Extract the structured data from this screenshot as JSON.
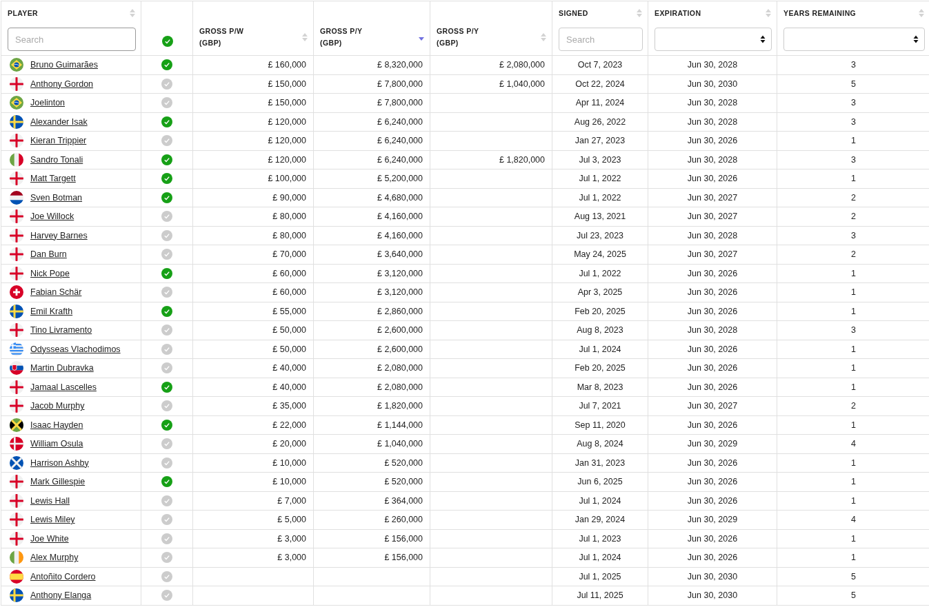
{
  "columns": [
    {
      "kind": "player",
      "label": "PLAYER",
      "sorted": false,
      "filter": {
        "kind": "search",
        "placeholder": "Search"
      }
    },
    {
      "kind": "check"
    },
    {
      "kind": "money",
      "label": "GROSS P/W",
      "sublabel": "(GBP)",
      "sorted": false
    },
    {
      "kind": "money",
      "label": "GROSS P/Y",
      "sublabel": "(GBP)",
      "sorted": true
    },
    {
      "kind": "money",
      "label": "GROSS P/Y",
      "sublabel": "(GBP)",
      "sorted": false
    },
    {
      "kind": "date",
      "label": "SIGNED",
      "sorted": false,
      "filter": {
        "kind": "search",
        "placeholder": "Search"
      }
    },
    {
      "kind": "date",
      "label": "EXPIRATION",
      "sorted": false,
      "filter": {
        "kind": "select"
      }
    },
    {
      "kind": "number",
      "label": "YEARS REMAINING",
      "sorted": false,
      "filter": {
        "kind": "select"
      }
    }
  ],
  "rows": [
    {
      "flag": {
        "kind": "br"
      },
      "name": "Bruno Guimarães",
      "verified": true,
      "pw": "£ 160,000",
      "py": "£ 8,320,000",
      "py2": "£ 2,080,000",
      "signed": "Oct 7, 2023",
      "expiration": "Jun 30, 2028",
      "years": "3"
    },
    {
      "flag": {
        "kind": "en"
      },
      "name": "Anthony Gordon",
      "verified": false,
      "pw": "£ 150,000",
      "py": "£ 7,800,000",
      "py2": "£ 1,040,000",
      "signed": "Oct 22, 2024",
      "expiration": "Jun 30, 2030",
      "years": "5"
    },
    {
      "flag": {
        "kind": "br"
      },
      "name": "Joelinton",
      "verified": false,
      "pw": "£ 150,000",
      "py": "£ 7,800,000",
      "signed": "Apr 11, 2024",
      "expiration": "Jun 30, 2028",
      "years": "3"
    },
    {
      "flag": {
        "kind": "se"
      },
      "name": "Alexander Isak",
      "verified": true,
      "pw": "£ 120,000",
      "py": "£ 6,240,000",
      "signed": "Aug 26, 2022",
      "expiration": "Jun 30, 2028",
      "years": "3"
    },
    {
      "flag": {
        "kind": "en"
      },
      "name": "Kieran Trippier",
      "verified": false,
      "pw": "£ 120,000",
      "py": "£ 6,240,000",
      "signed": "Jan 27, 2023",
      "expiration": "Jun 30, 2026",
      "years": "1"
    },
    {
      "flag": {
        "kind": "it"
      },
      "name": "Sandro Tonali",
      "verified": true,
      "pw": "£ 120,000",
      "py": "£ 6,240,000",
      "py2": "£ 1,820,000",
      "signed": "Jul 3, 2023",
      "expiration": "Jun 30, 2028",
      "years": "3"
    },
    {
      "flag": {
        "kind": "en"
      },
      "name": "Matt Targett",
      "verified": true,
      "pw": "£ 100,000",
      "py": "£ 5,200,000",
      "signed": "Jul 1, 2022",
      "expiration": "Jun 30, 2026",
      "years": "1"
    },
    {
      "flag": {
        "kind": "nl"
      },
      "name": "Sven Botman",
      "verified": true,
      "pw": "£ 90,000",
      "py": "£ 4,680,000",
      "signed": "Jul 1, 2022",
      "expiration": "Jun 30, 2027",
      "years": "2"
    },
    {
      "flag": {
        "kind": "en"
      },
      "name": "Joe Willock",
      "verified": false,
      "pw": "£ 80,000",
      "py": "£ 4,160,000",
      "signed": "Aug 13, 2021",
      "expiration": "Jun 30, 2027",
      "years": "2"
    },
    {
      "flag": {
        "kind": "en"
      },
      "name": "Harvey Barnes",
      "verified": false,
      "pw": "£ 80,000",
      "py": "£ 4,160,000",
      "signed": "Jul 23, 2023",
      "expiration": "Jun 30, 2028",
      "years": "3"
    },
    {
      "flag": {
        "kind": "en"
      },
      "name": "Dan Burn",
      "verified": false,
      "pw": "£ 70,000",
      "py": "£ 3,640,000",
      "signed": "May 24, 2025",
      "expiration": "Jun 30, 2027",
      "years": "2"
    },
    {
      "flag": {
        "kind": "en"
      },
      "name": "Nick Pope",
      "verified": true,
      "pw": "£ 60,000",
      "py": "£ 3,120,000",
      "signed": "Jul 1, 2022",
      "expiration": "Jun 30, 2026",
      "years": "1"
    },
    {
      "flag": {
        "kind": "ch"
      },
      "name": "Fabian Schär",
      "verified": false,
      "pw": "£ 60,000",
      "py": "£ 3,120,000",
      "signed": "Apr 3, 2025",
      "expiration": "Jun 30, 2026",
      "years": "1"
    },
    {
      "flag": {
        "kind": "se"
      },
      "name": "Emil Krafth",
      "verified": true,
      "pw": "£ 55,000",
      "py": "£ 2,860,000",
      "signed": "Feb 20, 2025",
      "expiration": "Jun 30, 2026",
      "years": "1"
    },
    {
      "flag": {
        "kind": "en"
      },
      "name": "Tino Livramento",
      "verified": false,
      "pw": "£ 50,000",
      "py": "£ 2,600,000",
      "signed": "Aug 8, 2023",
      "expiration": "Jun 30, 2028",
      "years": "3"
    },
    {
      "flag": {
        "kind": "gr"
      },
      "name": "Odysseas Vlachodimos",
      "verified": false,
      "pw": "£ 50,000",
      "py": "£ 2,600,000",
      "signed": "Jul 1, 2024",
      "expiration": "Jun 30, 2026",
      "years": "1"
    },
    {
      "flag": {
        "kind": "sk"
      },
      "name": "Martin Dubravka",
      "verified": false,
      "pw": "£ 40,000",
      "py": "£ 2,080,000",
      "signed": "Feb 20, 2025",
      "expiration": "Jun 30, 2026",
      "years": "1"
    },
    {
      "flag": {
        "kind": "en"
      },
      "name": "Jamaal Lascelles",
      "verified": true,
      "pw": "£ 40,000",
      "py": "£ 2,080,000",
      "signed": "Mar 8, 2023",
      "expiration": "Jun 30, 2026",
      "years": "1"
    },
    {
      "flag": {
        "kind": "en"
      },
      "name": "Jacob Murphy",
      "verified": false,
      "pw": "£ 35,000",
      "py": "£ 1,820,000",
      "signed": "Jul 7, 2021",
      "expiration": "Jun 30, 2027",
      "years": "2"
    },
    {
      "flag": {
        "kind": "jm"
      },
      "name": "Isaac Hayden",
      "verified": true,
      "pw": "£ 22,000",
      "py": "£ 1,144,000",
      "signed": "Sep 11, 2020",
      "expiration": "Jun 30, 2026",
      "years": "1"
    },
    {
      "flag": {
        "kind": "dk"
      },
      "name": "William Osula",
      "verified": false,
      "pw": "£ 20,000",
      "py": "£ 1,040,000",
      "signed": "Aug 8, 2024",
      "expiration": "Jun 30, 2029",
      "years": "4"
    },
    {
      "flag": {
        "kind": "sco"
      },
      "name": "Harrison Ashby",
      "verified": false,
      "pw": "£ 10,000",
      "py": "£ 520,000",
      "signed": "Jan 31, 2023",
      "expiration": "Jun 30, 2026",
      "years": "1"
    },
    {
      "flag": {
        "kind": "en"
      },
      "name": "Mark Gillespie",
      "verified": true,
      "pw": "£ 10,000",
      "py": "£ 520,000",
      "signed": "Jun 6, 2025",
      "expiration": "Jun 30, 2026",
      "years": "1"
    },
    {
      "flag": {
        "kind": "en"
      },
      "name": "Lewis Hall",
      "verified": false,
      "pw": "£ 7,000",
      "py": "£ 364,000",
      "signed": "Jul 1, 2024",
      "expiration": "Jun 30, 2026",
      "years": "1"
    },
    {
      "flag": {
        "kind": "en"
      },
      "name": "Lewis Miley",
      "verified": false,
      "pw": "£ 5,000",
      "py": "£ 260,000",
      "signed": "Jan 29, 2024",
      "expiration": "Jun 30, 2029",
      "years": "4"
    },
    {
      "flag": {
        "kind": "en"
      },
      "name": "Joe White",
      "verified": false,
      "pw": "£ 3,000",
      "py": "£ 156,000",
      "signed": "Jul 1, 2023",
      "expiration": "Jun 30, 2026",
      "years": "1"
    },
    {
      "flag": {
        "kind": "ie"
      },
      "name": "Alex Murphy",
      "verified": false,
      "pw": "£ 3,000",
      "py": "£ 156,000",
      "signed": "Jul 1, 2024",
      "expiration": "Jun 30, 2026",
      "years": "1"
    },
    {
      "flag": {
        "kind": "es"
      },
      "name": "Antoñito Cordero",
      "verified": false,
      "signed": "Jul 1, 2025",
      "expiration": "Jun 30, 2030",
      "years": "5"
    },
    {
      "flag": {
        "kind": "se"
      },
      "name": "Anthony Elanga",
      "verified": false,
      "signed": "Jul 11, 2025",
      "expiration": "Jun 30, 2030",
      "years": "5"
    }
  ]
}
